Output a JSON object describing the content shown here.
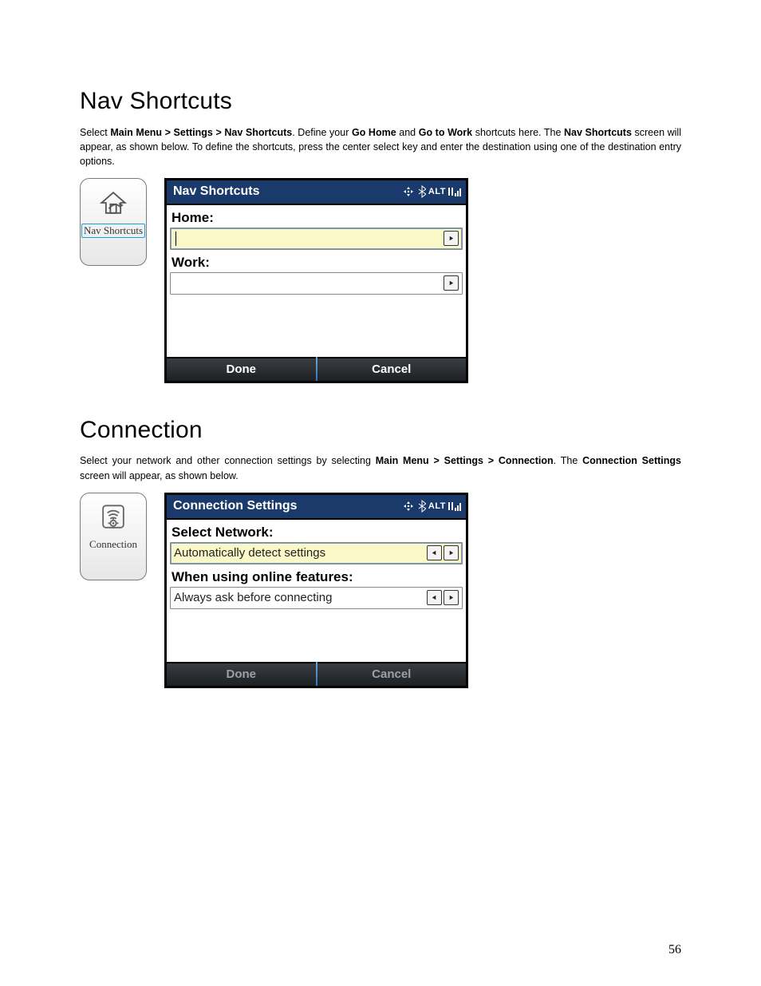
{
  "page_number": "56",
  "sec1": {
    "heading": "Nav Shortcuts",
    "para_parts": {
      "a": "Select ",
      "b": "Main Menu > Settings > Nav Shortcuts",
      "c": ". Define your ",
      "d": "Go Home",
      "e": " and ",
      "f": "Go to Work",
      "g": " shortcuts here. The ",
      "h": "Nav Shortcuts",
      "i": " screen will appear, as shown below. To define the shortcuts, press the center select key and enter the destination using one of the destination entry options."
    },
    "tile_caption": "Nav Shortcuts",
    "shot": {
      "title": "Nav Shortcuts",
      "status_alt": "ALT",
      "home_label": "Home:",
      "work_label": "Work:",
      "home_value": "",
      "work_value": "",
      "done": "Done",
      "cancel": "Cancel"
    }
  },
  "sec2": {
    "heading": "Connection",
    "para_parts": {
      "a": "Select your network and other connection settings by selecting ",
      "b": "Main Menu > Settings > Connection",
      "c": ". The ",
      "d": "Connection Settings",
      "e": " screen will appear, as shown below."
    },
    "tile_caption": "Connection",
    "shot": {
      "title": "Connection Settings",
      "status_alt": "ALT",
      "network_label": "Select Network:",
      "network_value": "Automatically detect settings",
      "online_label": "When using online features:",
      "online_value": "Always ask before connecting",
      "done": "Done",
      "cancel": "Cancel"
    }
  }
}
